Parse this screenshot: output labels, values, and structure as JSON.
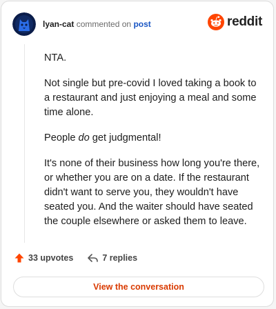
{
  "header": {
    "username": "lyan-cat",
    "action_text": "commented on",
    "post_link": "post",
    "brand_name": "reddit"
  },
  "comment": {
    "p1": "NTA.",
    "p2": "Not single but pre-covid I loved taking a book to a restaurant and just enjoying a meal and some time alone.",
    "p3_before": "People ",
    "p3_emphasis": "do",
    "p3_after": " get judgmental!",
    "p4": "It's none of their business how long you're there, or whether you are on a date. If the restaurant didn't want to serve you, they wouldn't have seated you. And the waiter should have seated the couple elsewhere or asked them to leave."
  },
  "actions": {
    "upvotes": "33 upvotes",
    "replies": "7 replies"
  },
  "cta": {
    "label": "View the conversation"
  },
  "icons": {
    "upvote": "upvote-arrow-icon",
    "reply": "reply-arrow-icon",
    "brand": "reddit-snoo-icon",
    "avatar": "cat-avatar"
  },
  "colors": {
    "accent": "#d93a00",
    "brand_orange": "#ff4500",
    "link": "#1a56c4",
    "avatar_bg": "#0b1d4a",
    "avatar_cat": "#2b6de8"
  }
}
